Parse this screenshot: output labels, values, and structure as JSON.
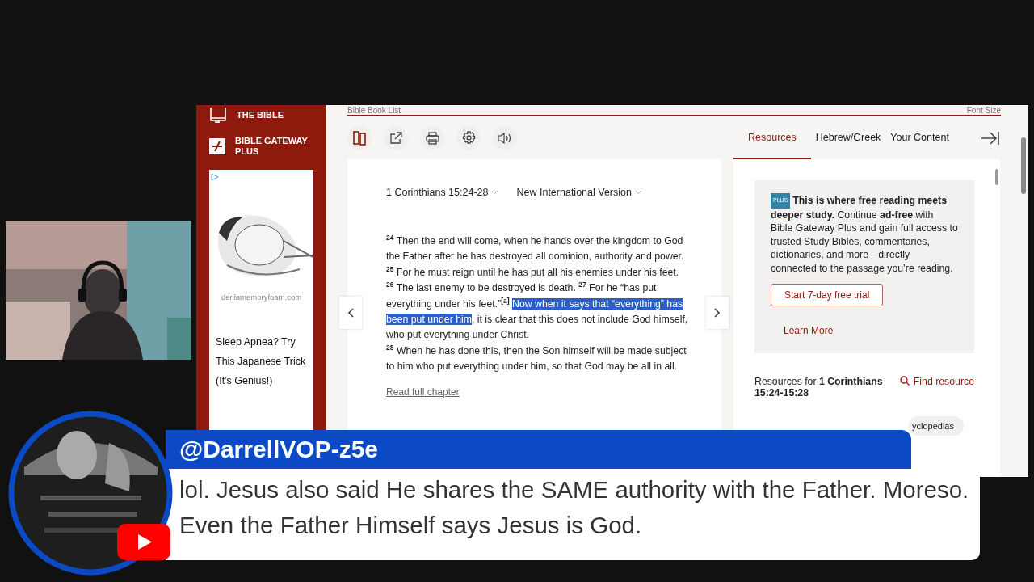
{
  "browser": {
    "top_bar": {
      "book_list": "Bible Book List",
      "font_size": "Font Size"
    },
    "sidebar": {
      "items": [
        {
          "kind": "book",
          "label": "THE BIBLE"
        },
        {
          "kind": "plus",
          "label": "BIBLE GATEWAY PLUS"
        }
      ],
      "ad": {
        "kind": "picture",
        "domain": "derilamemoryfoam.com",
        "headline": "Sleep Apnea? Try This Japanese Trick (It's Genius!)"
      }
    },
    "toolbar": [
      {
        "kind": "parallel"
      },
      {
        "kind": "share"
      },
      {
        "kind": "print"
      },
      {
        "kind": "settings"
      },
      {
        "kind": "audio"
      }
    ],
    "passage": {
      "reference": "1 Corinthians 15:24-28",
      "version": "New International Version",
      "paragraphs": [
        [
          {
            "text": "$^{24}$ Then the end will come, when he hands over the kingdom to God the Father after he has destroyed all dominion, authority and power. $^{25}$ For he must reign until he has put all his enemies under his feet. $^{26}$ The last enemy to be destroyed is death. $^{27}$ For he “has put everything under his feet.”$^{[a]}$ ",
            "selected": false
          },
          {
            "text": "Now when it says that “everything” has been put under him",
            "selected": true
          },
          {
            "text": ", it is clear that this does not include God himself, who put everything under Christ.",
            "selected": false
          }
        ],
        [
          {
            "text": "$^{28}$ When he has done this, then the Son himself will be made subject to him who put everything under him, so that God may be all in all.",
            "selected": false
          }
        ]
      ],
      "read_full": "Read full chapter"
    },
    "tabs": [
      {
        "label": "Resources",
        "selected": true
      },
      {
        "label": "Hebrew/Greek",
        "selected": false
      },
      {
        "label": "Your Content",
        "selected": false
      }
    ],
    "promo": {
      "badge": "PLUS",
      "text": "**This is where free reading meets deeper study.** Continue **ad-free** with Bible Gateway Plus and gain full access to trusted Study Bibles, commentaries, dictionaries, and more—directly connected to the passage you’re reading.",
      "trial_button": "Start 7-day free trial",
      "learn_more": "Learn More"
    },
    "resources": {
      "heading": "Resources for **1 Corinthians 15:24-15:28**",
      "find": "Find resource",
      "chip": "yclopedias"
    }
  },
  "comment": {
    "author": "@DarrellVOP-z5e",
    "text": "lol. Jesus also said He shares the SAME authority with the Father. Moreso. Even the Father Himself says Jesus is God."
  }
}
